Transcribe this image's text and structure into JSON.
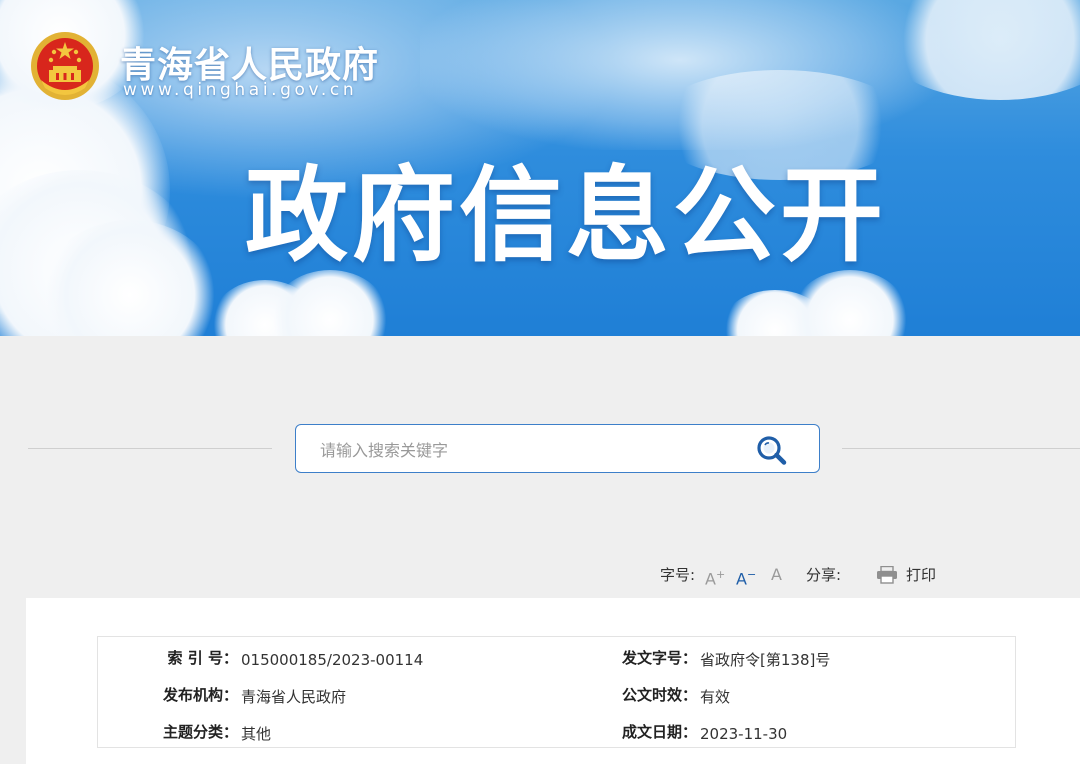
{
  "header": {
    "site_name": "青海省人民政府",
    "site_url": "www.qinghai.gov.cn",
    "banner_title": "政府信息公开"
  },
  "search": {
    "placeholder": "请输入搜索关键字",
    "value": ""
  },
  "toolbar": {
    "font_size_label": "字号:",
    "font_increase": "A",
    "font_increase_mark": "+",
    "font_decrease": "A",
    "font_decrease_mark": "−",
    "font_reset": "A",
    "share_label": "分享:",
    "print_label": "打印"
  },
  "metadata": {
    "index_label": "索 引 号：",
    "index_value": "015000185/2023-00114",
    "doc_number_label": "发文字号：",
    "doc_number_value": "省政府令[第138]号",
    "publisher_label": "发布机构：",
    "publisher_value": "青海省人民政府",
    "validity_label": "公文时效：",
    "validity_value": "有效",
    "category_label": "主题分类：",
    "category_value": "其他",
    "date_label": "成文日期：",
    "date_value": "2023-11-30"
  },
  "colors": {
    "accent_blue": "#3d7fc9",
    "banner_blue": "#2f8ddd",
    "emblem_red": "#d8261c",
    "emblem_gold": "#f3c63f"
  }
}
